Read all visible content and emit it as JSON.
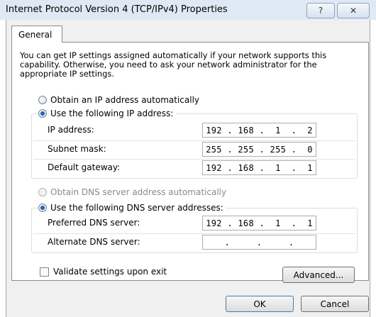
{
  "window": {
    "title": "Internet Protocol Version 4 (TCP/IPv4) Properties",
    "help_glyph": "?",
    "close_glyph": "✕"
  },
  "tabs": [
    {
      "label": "General"
    }
  ],
  "description": "You can get IP settings assigned automatically if your network supports this capability. Otherwise, you need to ask your network administrator for the appropriate IP settings.",
  "ip": {
    "auto_label": "Obtain an IP address automatically",
    "manual_label": "Use the following IP address:",
    "fields": [
      {
        "label": "IP address:",
        "value": "192 . 168 .  1  .  2"
      },
      {
        "label": "Subnet mask:",
        "value": "255 . 255 . 255 .  0"
      },
      {
        "label": "Default gateway:",
        "value": "192 . 168 .  1  .  1"
      }
    ]
  },
  "dns": {
    "auto_label": "Obtain DNS server address automatically",
    "manual_label": "Use the following DNS server addresses:",
    "fields": [
      {
        "label": "Preferred DNS server:",
        "value": "192 . 168 .  1  .  1"
      },
      {
        "label": "Alternate DNS server:",
        "value": " .     .     . "
      }
    ]
  },
  "validate_label": "Validate settings upon exit",
  "buttons": {
    "advanced": "Advanced...",
    "ok": "OK",
    "cancel": "Cancel"
  },
  "icons": {
    "help": "help-icon",
    "close": "close-icon"
  }
}
